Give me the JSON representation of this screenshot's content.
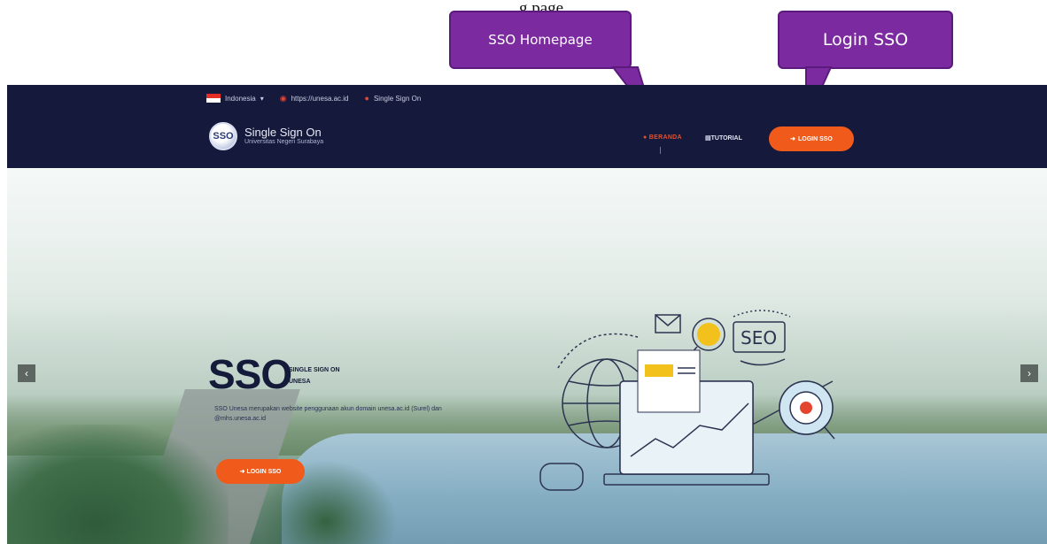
{
  "caption": "g                                                                        page",
  "callouts": {
    "homepage": "SSO Homepage",
    "login": "Login SSO"
  },
  "header": {
    "language": "Indonesia",
    "link_site": "https://unesa.ac.id",
    "link_sso": "Single Sign On",
    "brand_title": "Single Sign On",
    "brand_subtitle": "Universitas Negeri Surabaya",
    "logo_text": "SSO",
    "nav_home": "BERANDA",
    "nav_tutorial": "TUTORIAL",
    "nav_login": "LOGIN SSO"
  },
  "hero": {
    "title": "SSO",
    "tagline_1": "SINGLE SIGN ON",
    "tagline_2": "UNESA",
    "description": "SSO Unesa merupakan website penggunaan akun domain unesa.ac.id (Surel) dan @mhs.unesa.ac.id",
    "login_button": "LOGIN SSO",
    "prev_icon": "chevron-left-icon",
    "next_icon": "chevron-right-icon",
    "illustration_label": "SEO"
  },
  "colors": {
    "header_bg": "#151a3d",
    "accent": "#f05a1a",
    "callout": "#7b2aa0"
  }
}
